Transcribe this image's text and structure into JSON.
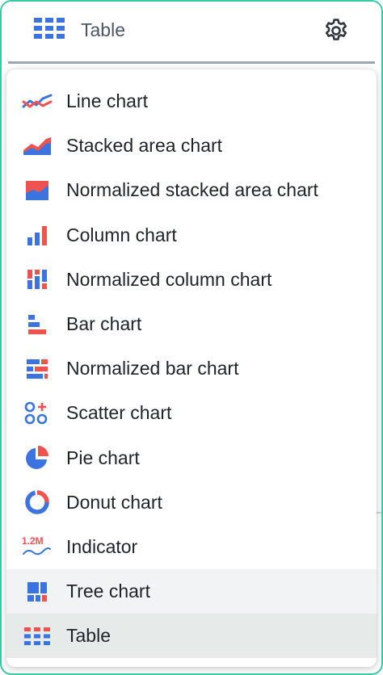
{
  "header": {
    "chart_type_label": "Table",
    "chart_type_icon": "table-icon",
    "settings_icon": "gear-icon"
  },
  "colors": {
    "accent_blue": "#3b73e0",
    "accent_red": "#ef5350",
    "frame_border": "#35c9a5",
    "selected_row": "#e6ebea",
    "hover_row": "#f1f3f4"
  },
  "menu": {
    "items": [
      {
        "label": "Line chart",
        "icon": "line-chart-icon"
      },
      {
        "label": "Stacked area chart",
        "icon": "stacked-area-chart-icon"
      },
      {
        "label": "Normalized stacked area chart",
        "icon": "normalized-stacked-area-chart-icon"
      },
      {
        "label": "Column chart",
        "icon": "column-chart-icon"
      },
      {
        "label": "Normalized column chart",
        "icon": "normalized-column-chart-icon"
      },
      {
        "label": "Bar chart",
        "icon": "bar-chart-icon"
      },
      {
        "label": "Normalized bar chart",
        "icon": "normalized-bar-chart-icon"
      },
      {
        "label": "Scatter chart",
        "icon": "scatter-chart-icon"
      },
      {
        "label": "Pie chart",
        "icon": "pie-chart-icon"
      },
      {
        "label": "Donut chart",
        "icon": "donut-chart-icon"
      },
      {
        "label": "Indicator",
        "icon": "indicator-icon",
        "icon_text": "1.2M"
      },
      {
        "label": "Tree chart",
        "icon": "tree-chart-icon",
        "state": "hover"
      },
      {
        "label": "Table",
        "icon": "table-icon",
        "state": "selected"
      }
    ]
  }
}
